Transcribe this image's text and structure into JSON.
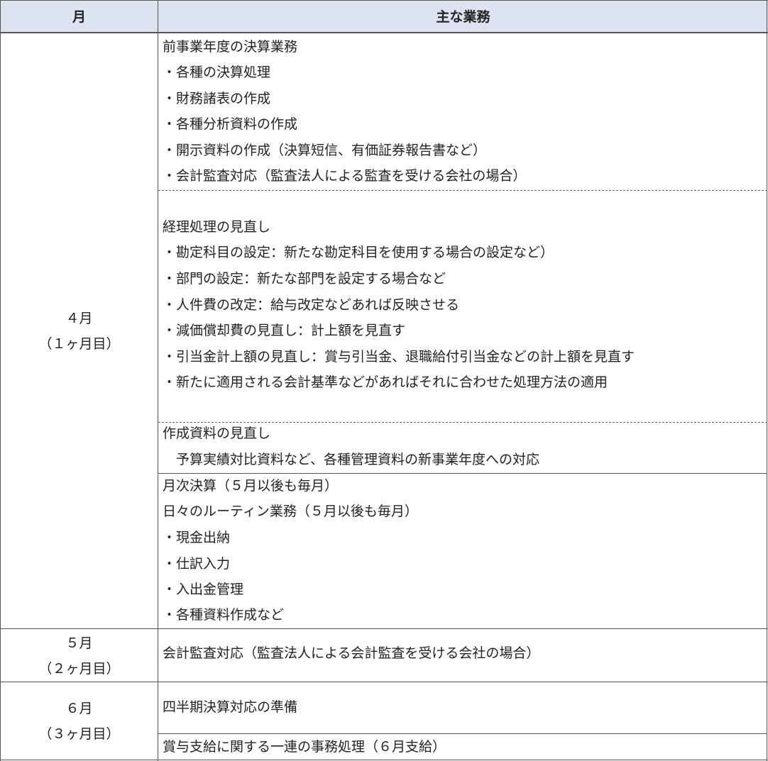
{
  "header": {
    "month": "月",
    "tasks": "主な業務"
  },
  "rows": [
    {
      "month": [
        "４月",
        "（１ヶ月目）"
      ],
      "blocks": [
        [
          "前事業年度の決算業務",
          "・各種の決算処理",
          "・財務諸表の作成",
          "・各種分析資料の作成",
          "・開示資料の作成（決算短信、有価証券報告書など）",
          "・会計監査対応（監査法人による監査を受ける会社の場合）"
        ],
        [
          "経理処理の見直し",
          "・勘定科目の設定：新たな勘定科目を使用する場合の設定など）",
          "・部門の設定：新たな部門を設定する場合など",
          "・人件費の改定：給与改定などあれば反映させる",
          "・減価償却費の見直し：計上額を見直す",
          "・引当金計上額の見直し：賞与引当金、退職給付引当金などの計上額を見直す",
          "・新たに適用される会計基準などがあればそれに合わせた処理方法の適用"
        ],
        [
          "作成資料の見直し",
          "　予算実績対比資料など、各種管理資料の新事業年度への対応"
        ],
        [
          "月次決算（５月以後も毎月）",
          "日々のルーティン業務（５月以後も毎月）",
          "・現金出納",
          "・仕訳入力",
          "・入出金管理",
          "・各種資料作成など"
        ]
      ]
    },
    {
      "month": [
        "５月",
        "（２ヶ月目）"
      ],
      "blocks": [
        [
          "会計監査対応（監査法人による会計監査を受ける会社の場合）"
        ]
      ]
    },
    {
      "month": [
        "６月",
        "（３ヶ月目）"
      ],
      "blocks": [
        [
          "四半期決算対応の準備"
        ],
        [
          "賞与支給に関する一連の事務処理（６月支給）"
        ]
      ]
    }
  ]
}
